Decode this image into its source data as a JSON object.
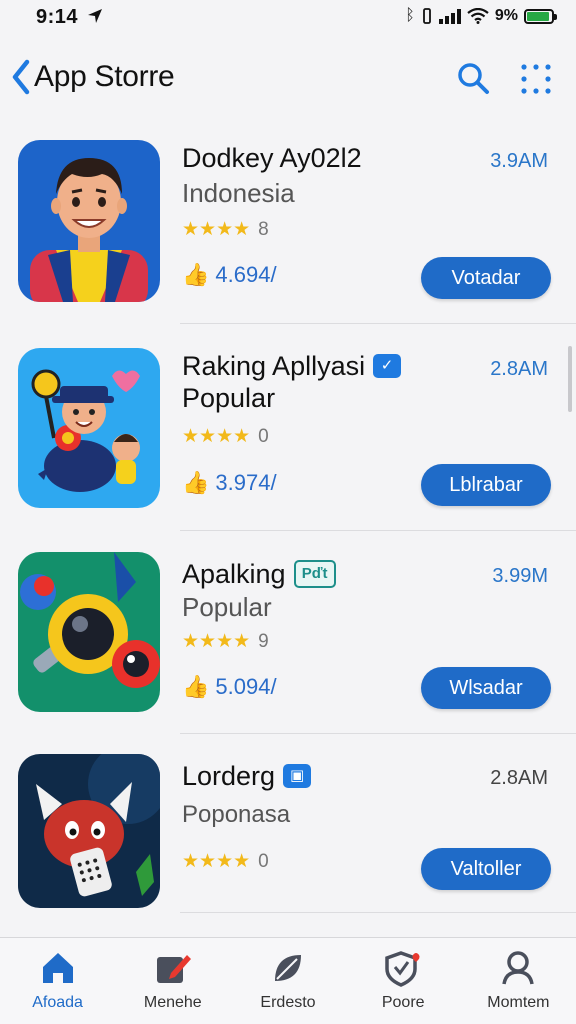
{
  "status_bar": {
    "time": "9:14",
    "battery_pct": "9%",
    "battery_level": 0.9
  },
  "header": {
    "title": "App Storre"
  },
  "apps": [
    {
      "name": "Dodkey Ay02l2",
      "subtitle": "Indonesia",
      "size": "3.9AM",
      "rating_count": "8",
      "likes": "4.694/",
      "button": "Votadar"
    },
    {
      "name": "Raking Apllyasi",
      "name_line2": "Popular",
      "size": "2.8AM",
      "rating_count": "0",
      "likes": "3.974/",
      "button": "Lblrabar"
    },
    {
      "name": "Apalking",
      "badge": "Pďt",
      "subtitle": "Popular",
      "size": "3.99M",
      "rating_count": "9",
      "likes": "5.094/",
      "button": "Wlsadar"
    },
    {
      "name": "Lorderg",
      "subtitle": "Poponasa",
      "size": "2.8AM",
      "rating_count": "0",
      "likes": "",
      "button": "Valtoller"
    }
  ],
  "tabs": [
    {
      "label": "Afoada",
      "icon": "home-icon"
    },
    {
      "label": "Menehe",
      "icon": "pen-icon"
    },
    {
      "label": "Erdesto",
      "icon": "leaf-icon"
    },
    {
      "label": "Poore",
      "icon": "shield-heart-icon"
    },
    {
      "label": "Momtem",
      "icon": "person-icon"
    }
  ],
  "colors": {
    "accent": "#1f6bc8",
    "star": "#f2b91a",
    "battery": "#27a844"
  }
}
